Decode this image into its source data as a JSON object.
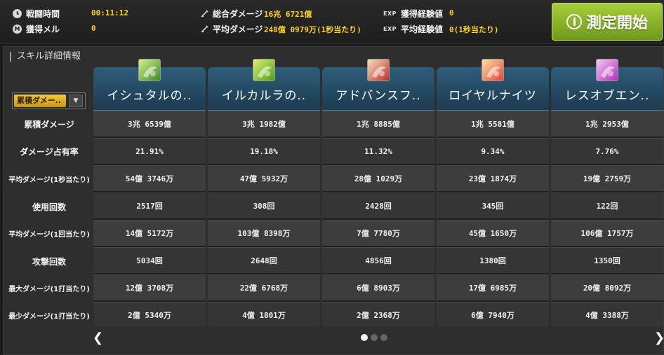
{
  "stats": {
    "battle_time_label": "戦闘時間",
    "battle_time_value": "00:11:12",
    "meso_label": "獲得メル",
    "meso_value": "0",
    "total_damage_label": "総合ダメージ",
    "total_damage_value": "16兆 6721億",
    "avg_damage_label": "平均ダメージ",
    "avg_damage_value": "248億 0979万(1秒当たり)",
    "exp_label": "獲得経験値",
    "exp_value": "0",
    "avg_exp_label": "平均経験値",
    "avg_exp_value": "0(1秒当たり)",
    "exp_tag": "EXP",
    "clock_icon": "clock-icon",
    "meso_icon": "meso-icon",
    "meso_glyph": "M"
  },
  "measure_button": {
    "label": "測定開始",
    "color": "#8db62b"
  },
  "section": {
    "title": "スキル詳細情報",
    "sort_selected": "累積ダメー..",
    "row_labels": [
      "累積ダメージ",
      "ダメージ占有率",
      "平均ダメージ(1秒当たり)",
      "使用回数",
      "平均ダメージ(1回当たり)",
      "攻撃回数",
      "最大ダメージ(1打当たり)",
      "最少ダメージ(1打当たり)"
    ]
  },
  "skills": [
    {
      "name": "イシュタルの..",
      "icon": "green-swirl-icon",
      "values": [
        "3兆 6539億",
        "21.91%",
        "54億 3746万",
        "2517回",
        "14億 5172万",
        "5034回",
        "12億 3708万",
        "2億 5340万"
      ]
    },
    {
      "name": "イルカルラの..",
      "icon": "green-leaf-icon",
      "values": [
        "3兆 1982億",
        "19.18%",
        "47億 5932万",
        "308回",
        "103億 8398万",
        "2648回",
        "22億 6768万",
        "4億 1801万"
      ]
    },
    {
      "name": "アドバンスフ..",
      "icon": "scroll-arrow-icon",
      "values": [
        "1兆 8885億",
        "11.32%",
        "28億 1029万",
        "2428回",
        "7億 7780万",
        "4856回",
        "6億 8903万",
        "2億 2368万"
      ]
    },
    {
      "name": "ロイヤルナイツ",
      "icon": "royal-knights-icon",
      "values": [
        "1兆 5581億",
        "9.34%",
        "23億 1874万",
        "345回",
        "45億 1650万",
        "1380回",
        "17億 6985万",
        "6億 7940万"
      ]
    },
    {
      "name": "レスオブエン..",
      "icon": "pink-spirit-icon",
      "values": [
        "1兆 2953億",
        "7.76%",
        "19億 2759万",
        "122回",
        "106億 1757万",
        "1350回",
        "20億 8092万",
        "4億 3388万"
      ]
    }
  ],
  "pagination": {
    "pages": 3,
    "current": 1
  }
}
